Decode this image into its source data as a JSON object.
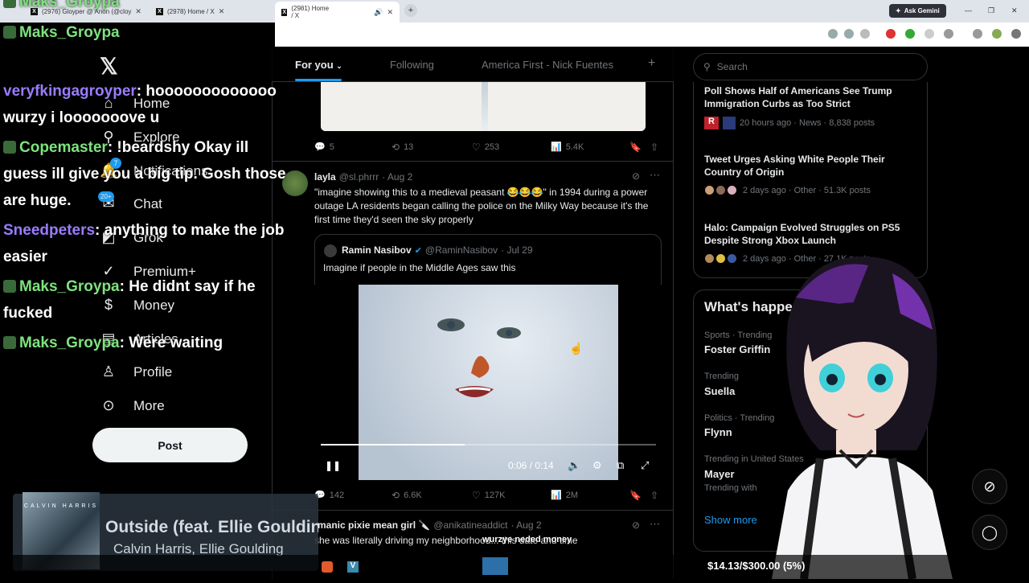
{
  "browser": {
    "tabs": [
      {
        "label": "(2976) Gloyper @ Anon (@cloy"
      },
      {
        "label": "(2978) Home / X"
      },
      {
        "label": "(2981) Home / X"
      }
    ],
    "new_tab": "+",
    "ask_gemini": "Ask Gemini",
    "window_controls": [
      "—",
      "❐",
      "✕"
    ]
  },
  "chat": {
    "messages": [
      {
        "user": "Maks_Groypa",
        "text": ""
      },
      {
        "user": "Maks_Groypa",
        "text": ""
      },
      {
        "user": "veryfkingagroyper",
        "text": ": hooooooooooooo wurzy i looooooove u"
      },
      {
        "user": "Copemaster",
        "text": ": !beardshy Okay ill guess ill give you a big tip. Gosh those are huge."
      },
      {
        "user": "Sneedpeters",
        "text": ": anything to make the job easier"
      },
      {
        "user": "Maks_Groypa",
        "text": ": He didnt say if he fucked"
      },
      {
        "user": "Maks_Groypa",
        "text": ": Were waiting"
      }
    ]
  },
  "sidebar": {
    "logo": "𝕏",
    "items": [
      {
        "label": "Home",
        "icon": "⌂"
      },
      {
        "label": "Explore",
        "icon": "⚲"
      },
      {
        "label": "Notifications",
        "icon": "🔔"
      },
      {
        "label": "Chat",
        "icon": "✉"
      },
      {
        "label": "Grok",
        "icon": "◩"
      },
      {
        "label": "Premium+",
        "icon": "✓"
      },
      {
        "label": "Money",
        "icon": "$"
      },
      {
        "label": "Articles",
        "icon": "▤"
      },
      {
        "label": "Profile",
        "icon": "♙"
      },
      {
        "label": "More",
        "icon": "⊙"
      }
    ],
    "notif_badge": "7",
    "chat_badge": "20+",
    "post_label": "Post"
  },
  "now_playing": {
    "title": "Outside (feat. Ellie Goulding)",
    "artist": "Calvin Harris, Ellie Goulding",
    "album_text": "CALVIN HARRIS"
  },
  "feed": {
    "tabs": [
      "For you",
      "Following",
      "America First - Nick Fuentes"
    ],
    "add_tab": "+",
    "tweet0": {
      "replies": "5",
      "reposts": "13",
      "likes": "253",
      "views": "5.4K"
    },
    "tweet1": {
      "name": "layla",
      "handle": "@sl.phrrr",
      "date": "· Aug 2",
      "text": "\"imagine showing this to a medieval peasant 😂😂😂\" in 1994 during a power outage LA residents began calling the police on the Milky Way because it's the first time they'd seen the sky properly",
      "quote": {
        "name": "Ramin Nasibov",
        "handle": "@RaminNasibov",
        "date": "· Jul 29",
        "text": "Imagine if people in the Middle Ages saw this"
      },
      "video_time": "0:06 / 0:14",
      "video_progress": 0.43,
      "replies": "142",
      "reposts": "6.6K",
      "likes": "127K",
      "views": "2M"
    },
    "tweet2": {
      "name": "manic pixie mean girl 🔪",
      "handle": "@anikatineaddict",
      "date": "· Aug 2",
      "text": "she was literally driving my neighborhood... this date and time"
    }
  },
  "right": {
    "search_placeholder": "Search",
    "news": [
      {
        "title": "Poll Shows Half of Americans See Trump Immigration Curbs as Too Strict",
        "meta": "20 hours ago · News · 8,838 posts"
      },
      {
        "title": "Tweet Urges Asking White People Their Country of Origin",
        "meta": "2 days ago · Other · 51.3K posts"
      },
      {
        "title": "Halo: Campaign Evolved Struggles on PS5 Despite Strong Xbox Launch",
        "meta": "2 days ago · Other · 27.1K posts"
      }
    ],
    "trends_header": "What's happening",
    "trends": [
      {
        "category": "Sports · Trending",
        "name": "Foster Griffin"
      },
      {
        "category": "Trending",
        "name": "Suella"
      },
      {
        "category": "Politics · Trending",
        "name": "Flynn"
      },
      {
        "category": "Trending in United States",
        "name": "Mayer",
        "extra": "Trending with"
      }
    ],
    "show_more": "Show more"
  },
  "overlay": {
    "donation_text": "wurzye neded money",
    "money": "$14.13/$300.00 (5%)"
  }
}
